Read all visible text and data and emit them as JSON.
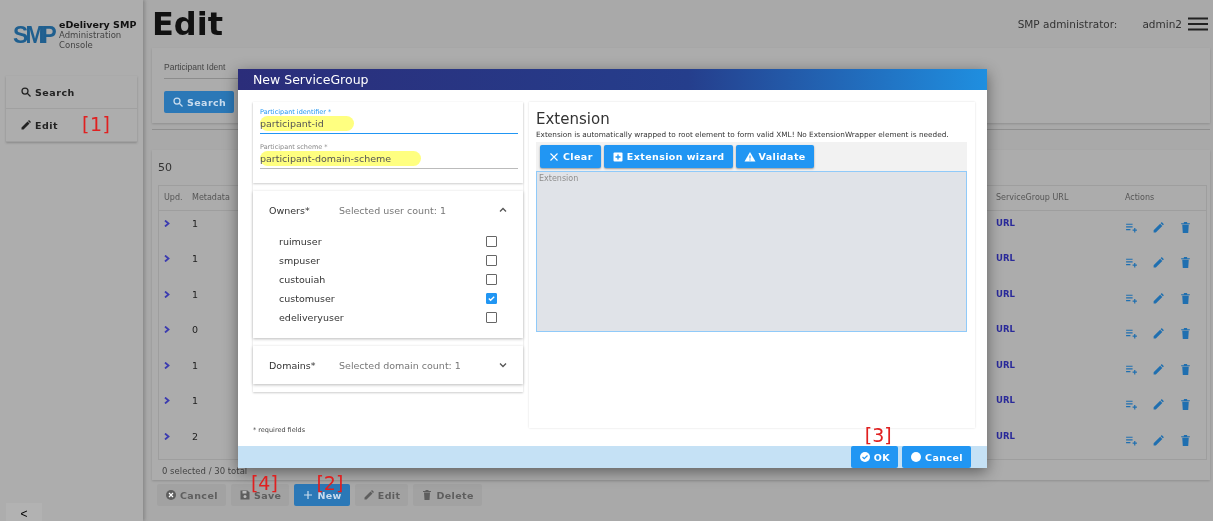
{
  "sidebar": {
    "logo": {
      "mark": "SMP",
      "title": "eDelivery SMP",
      "subtitle": "Administration Console"
    },
    "items": [
      {
        "label": "Search"
      },
      {
        "label": "Edit",
        "annotation": "[1]"
      }
    ],
    "collapse": "<"
  },
  "header": {
    "title": "Edit",
    "user_label": "SMP administrator:",
    "user": "admin2"
  },
  "search_panel": {
    "field_label": "Participant Ident",
    "button": "Search"
  },
  "table": {
    "page_size": "50",
    "columns": [
      "Upd.",
      "Metadata",
      "ServiceGroup URL",
      "Actions"
    ],
    "rows": [
      {
        "metadata": "1",
        "url": "URL"
      },
      {
        "metadata": "1",
        "url": "URL"
      },
      {
        "metadata": "1",
        "url": "URL"
      },
      {
        "metadata": "0",
        "url": "URL"
      },
      {
        "metadata": "1",
        "url": "URL"
      },
      {
        "metadata": "1",
        "url": "URL"
      },
      {
        "metadata": "2",
        "url": "URL"
      }
    ],
    "footer": "0 selected / 30 total"
  },
  "buttons": [
    {
      "label": "Cancel",
      "disabled": true
    },
    {
      "label": "Save",
      "disabled": true,
      "annotation": "[4]"
    },
    {
      "label": "New",
      "disabled": false,
      "annotation": "[2]"
    },
    {
      "label": "Edit",
      "disabled": true
    },
    {
      "label": "Delete",
      "disabled": true
    }
  ],
  "dialog": {
    "title": "New ServiceGroup",
    "fields": [
      {
        "label": "Participant identifier *",
        "value": "participant-id",
        "focused": true,
        "highlighted": true
      },
      {
        "label": "Participant scheme *",
        "value": "participant-domain-scheme",
        "focused": false,
        "highlighted": true
      }
    ],
    "owners": {
      "title": "Owners*",
      "summary": "Selected user count: 1",
      "expanded": true,
      "users": [
        {
          "name": "ruimuser",
          "checked": false
        },
        {
          "name": "smpuser",
          "checked": false
        },
        {
          "name": "custouiah",
          "checked": false
        },
        {
          "name": "customuser",
          "checked": true
        },
        {
          "name": "edeliveryuser",
          "checked": false
        }
      ]
    },
    "domains": {
      "title": "Domains*",
      "summary": "Selected domain count: 1",
      "expanded": false
    },
    "required_note": "* required fields",
    "extension": {
      "title": "Extension",
      "description": "Extension is automatically wrapped to root element to form valid XML! No ExtensionWrapper element is needed.",
      "buttons": [
        {
          "label": "Clear"
        },
        {
          "label": "Extension wizard"
        },
        {
          "label": "Validate"
        }
      ],
      "placeholder": "Extension"
    },
    "actions": [
      {
        "label": "OK",
        "annotation": "[3]"
      },
      {
        "label": "Cancel"
      }
    ]
  }
}
